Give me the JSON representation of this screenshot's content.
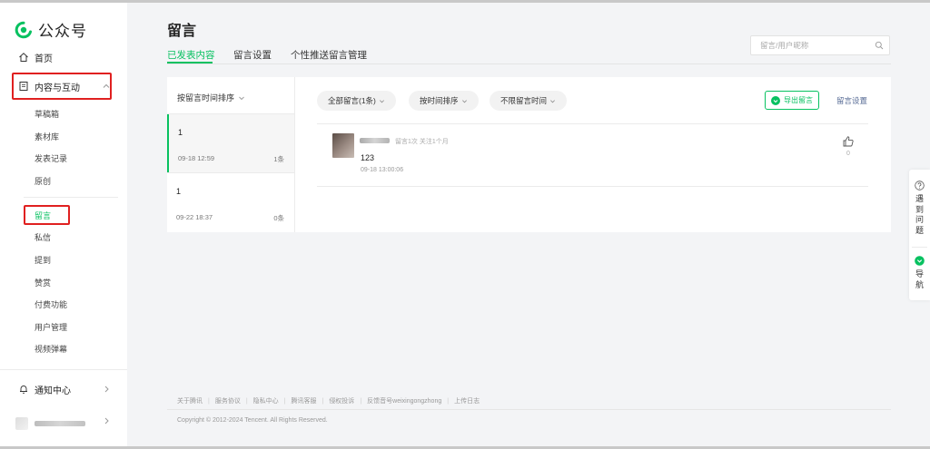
{
  "app": {
    "logo_text": "公众号"
  },
  "sidebar": {
    "home_label": "首页",
    "content_label": "内容与互动",
    "sub_items": [
      "草稿箱",
      "素材库",
      "发表记录",
      "原创",
      "留言",
      "私信",
      "提到",
      "赞赏",
      "付费功能",
      "用户管理",
      "视频弹幕"
    ],
    "active_item": "留言",
    "notify_label": "通知中心"
  },
  "header": {
    "title": "留言",
    "tabs": [
      "已发表内容",
      "留言设置",
      "个性推送留言管理"
    ],
    "active_tab": "已发表内容",
    "search_placeholder": "留言/用户昵称"
  },
  "list": {
    "sort_label": "按留言时间排序",
    "articles": [
      {
        "title": "1",
        "date": "09-18 12:59",
        "count": "1条"
      },
      {
        "title": "1",
        "date": "09-22 18:37",
        "count": "0条"
      }
    ]
  },
  "filters": {
    "all_comments": "全部留言(1条)",
    "sort_by_time": "按时间排序",
    "time_range": "不限留言时间"
  },
  "actions": {
    "export_label": "导出留言",
    "settings_label": "留言设置"
  },
  "comment": {
    "meta": "留言1次 关注1个月",
    "text": "123",
    "time": "09-18 13:00:06",
    "likes": "0"
  },
  "footer": {
    "links": [
      "关于腾讯",
      "服务协议",
      "隐私中心",
      "腾讯客服",
      "侵权投诉",
      "反馈音号weixingongzhong",
      "上传日志"
    ],
    "copyright": "Copyright © 2012-2024 Tencent. All Rights Reserved."
  },
  "float_panel": {
    "help_label": [
      "遇",
      "到",
      "问",
      "题"
    ],
    "guide_label": [
      "导",
      "航"
    ]
  },
  "colors": {
    "accent": "#07c160",
    "highlight_box": "#e02020",
    "link": "#576b95"
  }
}
